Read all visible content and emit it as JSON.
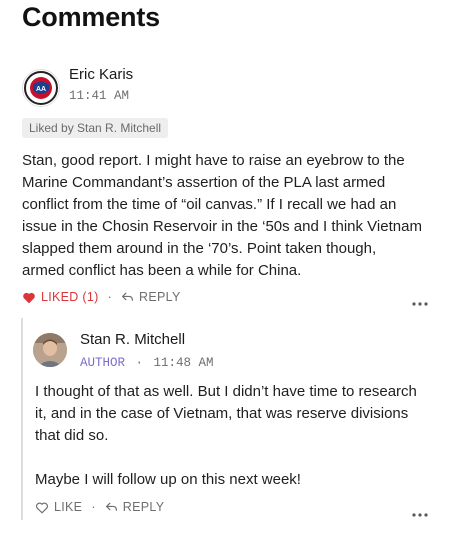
{
  "section": {
    "title": "Comments"
  },
  "comments": [
    {
      "author": "Eric Karis",
      "time": "11:41 AM",
      "liked_by": "Liked by Stan R. Mitchell",
      "body": [
        "Stan, good report.  I might have to raise an eyebrow to the",
        "Marine Commandant’s assertion of the PLA last armed",
        "conflict from the time of “oil canvas.”  If I recall we had an",
        "issue in the Chosin Reservoir in the ‘50s and I think Vietnam",
        "slapped them around in the ‘70’s.  Point taken though,",
        "armed conflict has been a while for China."
      ],
      "like_label": "LIKED (1)",
      "reply_label": "REPLY",
      "accent": "#d9353a"
    },
    {
      "author": "Stan R. Mitchell",
      "badge": "AUTHOR",
      "time": "11:48 AM",
      "body": [
        "I thought of that as well. But I didn’t have time to research",
        "it, and in the case of Vietnam, that was reserve divisions",
        "that did so.",
        "",
        "Maybe I will follow up on this next week!"
      ],
      "like_label": "LIKE",
      "reply_label": "REPLY",
      "badge_color": "#7b6cc9"
    }
  ],
  "separator": "·",
  "icons": [
    "heart-filled-icon",
    "reply-arrow-icon",
    "more-options-icon",
    "heart-outline-icon"
  ]
}
